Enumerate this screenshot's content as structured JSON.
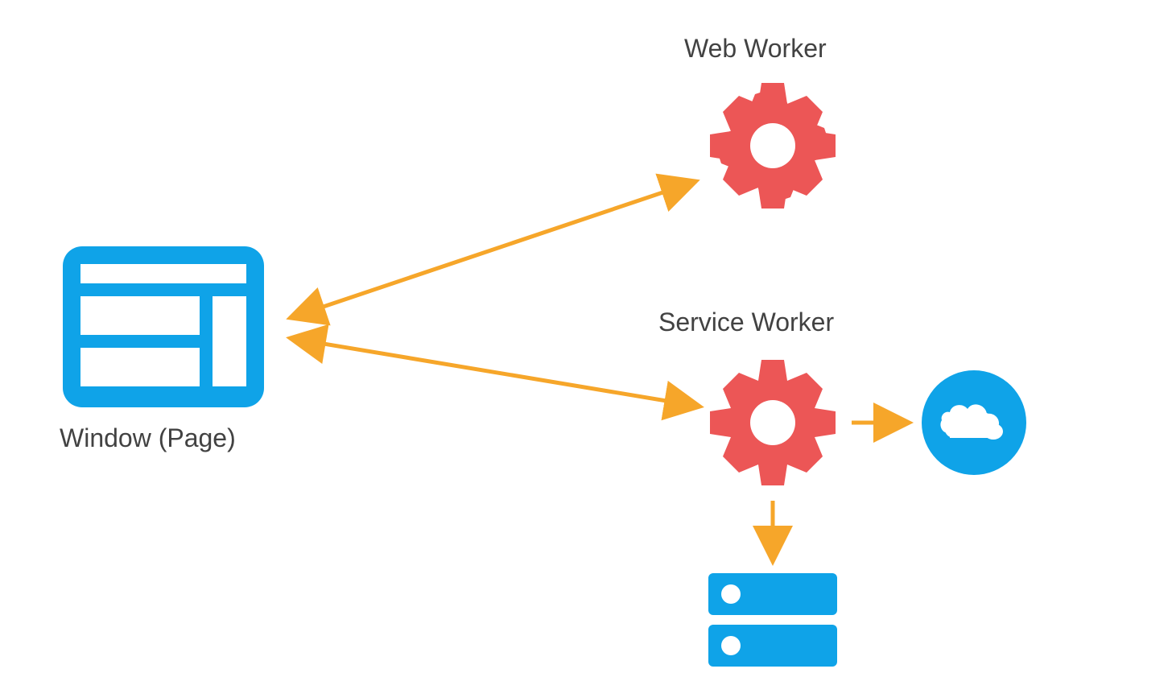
{
  "labels": {
    "window": "Window (Page)",
    "webWorker": "Web Worker",
    "serviceWorker": "Service Worker"
  },
  "colors": {
    "blue": "#0FA3E8",
    "red": "#EC5656",
    "orange": "#F6A62A",
    "text": "#424242"
  },
  "diagram": {
    "type": "architecture",
    "nodes": [
      {
        "id": "window",
        "label": "Window (Page)",
        "icon": "browser-window"
      },
      {
        "id": "webWorker",
        "label": "Web Worker",
        "icon": "gear"
      },
      {
        "id": "serviceWorker",
        "label": "Service Worker",
        "icon": "gear"
      },
      {
        "id": "cloud",
        "label": "",
        "icon": "cloud"
      },
      {
        "id": "storage",
        "label": "",
        "icon": "server-stack"
      }
    ],
    "edges": [
      {
        "from": "window",
        "to": "webWorker",
        "bidirectional": true
      },
      {
        "from": "window",
        "to": "serviceWorker",
        "bidirectional": true
      },
      {
        "from": "serviceWorker",
        "to": "cloud",
        "bidirectional": false
      },
      {
        "from": "serviceWorker",
        "to": "storage",
        "bidirectional": false
      }
    ]
  }
}
